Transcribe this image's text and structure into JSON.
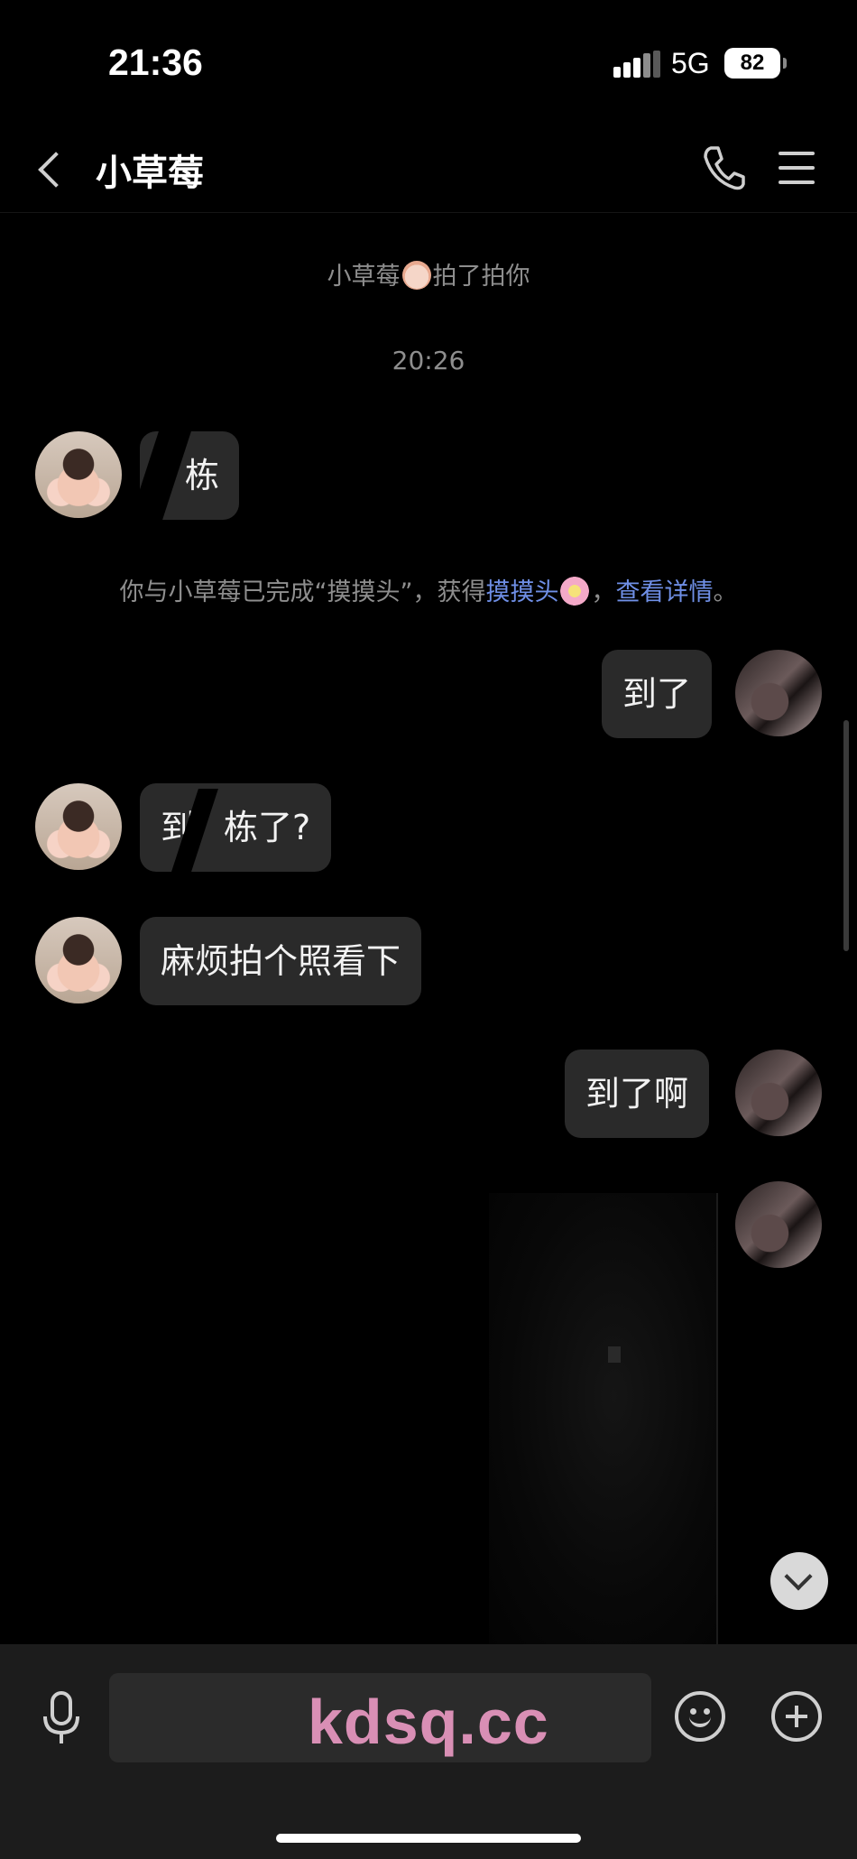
{
  "status_bar": {
    "time": "21:36",
    "network": "5G",
    "battery": "82"
  },
  "header": {
    "title": "小草莓",
    "back_icon": "chevron-left-icon",
    "call_icon": "phone-icon",
    "menu_icon": "hamburger-menu-icon"
  },
  "messages": {
    "pat_notice": {
      "name": "小草莓",
      "action": "拍了拍你"
    },
    "timestamp": "20:26",
    "m1_text": "栋",
    "achievement": {
      "prefix": "你与小草莓已完成“摸摸头”，获得",
      "badge": "摸摸头",
      "sep": "，",
      "details_link": "查看详情",
      "suffix": "。"
    },
    "m2_text": "到了",
    "m3_a": "到",
    "m3_b": "栋了?",
    "m4_text": "麻烦拍个照看下",
    "m5_text": "到了啊"
  },
  "input_bar": {
    "watermark": "kdsq.cc",
    "mic_icon": "microphone-icon",
    "emoji_icon": "smiley-icon",
    "plus_icon": "plus-circle-icon"
  },
  "colors": {
    "background": "#000000",
    "bubble": "#2a2a2a",
    "link": "#6f8fe6",
    "input_bar": "#1c1c1c",
    "watermark": "#d98fb5"
  }
}
